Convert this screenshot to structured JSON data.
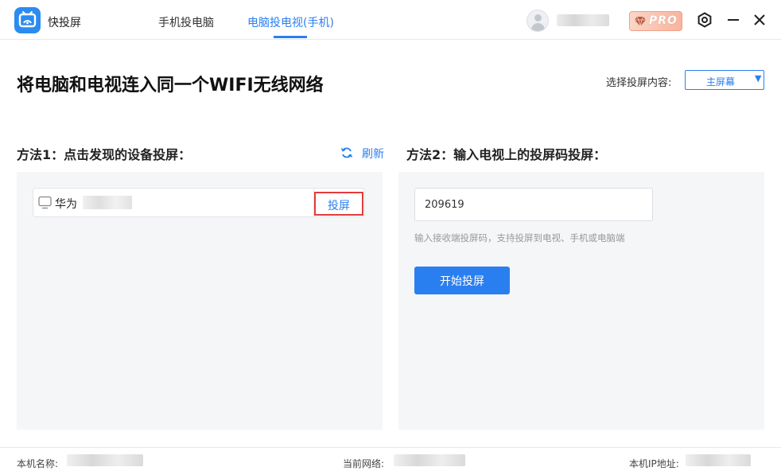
{
  "app": {
    "name": "快投屏"
  },
  "nav": {
    "tabs": [
      {
        "label": "手机投电脑",
        "active": false
      },
      {
        "label": "电脑投电视(手机)",
        "active": true
      }
    ]
  },
  "header": {
    "pro_label": "PRO"
  },
  "main": {
    "title": "将电脑和电视连入同一个WIFI无线网络",
    "select_label": "选择投屏内容:",
    "select_value": "主屏幕"
  },
  "method1": {
    "title": "方法1：点击发现的设备投屏：",
    "refresh_label": "刷新",
    "devices": [
      {
        "name": "华为",
        "action_label": "投屏"
      }
    ]
  },
  "method2": {
    "title": "方法2：输入电视上的投屏码投屏：",
    "code_value": "209619",
    "hint": "输入接收端投屏码，支持投屏到电视、手机或电脑端",
    "start_label": "开始投屏"
  },
  "footer": {
    "host_label": "本机名称:",
    "network_label": "当前网络:",
    "ip_label": "本机IP地址:"
  },
  "colors": {
    "accent": "#2a7ff0",
    "highlight_border": "#e33b3b",
    "panel_bg": "#f5f6f8"
  }
}
